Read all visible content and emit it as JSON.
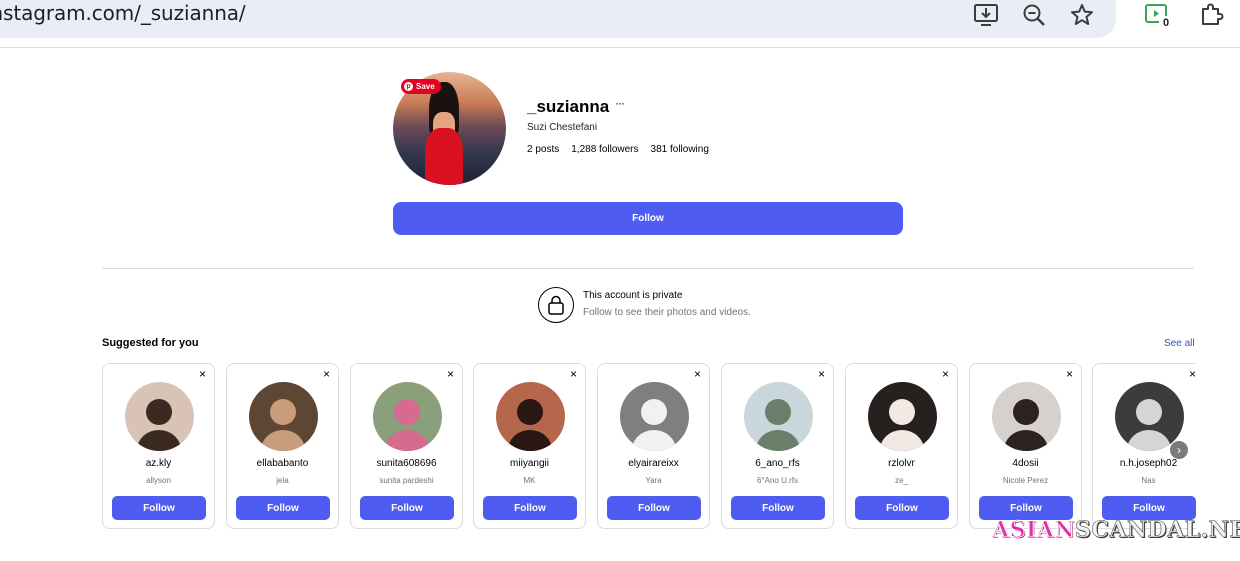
{
  "browser": {
    "url": "instagram.com/_suzianna/",
    "extension_badge": "0",
    "icons": [
      "install-app-icon",
      "zoom-out-icon",
      "bookmark-star-icon",
      "extension-icon",
      "extensions-puzzle-icon"
    ]
  },
  "profile": {
    "save_badge": "Save",
    "username": "_suzianna",
    "more": "···",
    "full_name": "Suzi Chestefani",
    "posts": "2 posts",
    "followers": "1,288 followers",
    "following": "381 following",
    "follow_label": "Follow"
  },
  "private_notice": {
    "title": "This account is private",
    "subtitle": "Follow to see their photos and videos."
  },
  "suggestions": {
    "title": "Suggested for you",
    "see_all": "See all",
    "close_symbol": "×",
    "items": [
      {
        "username": "az.kly",
        "name": "allyson",
        "button": "Follow",
        "bg": "#d9c3b5",
        "fg": "#3b2a22"
      },
      {
        "username": "ellababanto",
        "name": "jela",
        "button": "Follow",
        "bg": "#5d4634",
        "fg": "#c99c7c"
      },
      {
        "username": "sunita608696",
        "name": "sunita pardeshi",
        "button": "Follow",
        "bg": "#8aa07a",
        "fg": "#d66a8f"
      },
      {
        "username": "miiyangii",
        "name": "MK",
        "button": "Follow",
        "bg": "#b5674c",
        "fg": "#2a1612"
      },
      {
        "username": "elyairareixx",
        "name": "Yara",
        "button": "Follow",
        "bg": "#7f7f7f",
        "fg": "#f1f1f1"
      },
      {
        "username": "6_ano_rfs",
        "name": "6°Ano U.rfs",
        "button": "Follow",
        "bg": "#c9d7dc",
        "fg": "#6a7f6a"
      },
      {
        "username": "rzlolvr",
        "name": "ze_",
        "button": "Follow",
        "bg": "#26201e",
        "fg": "#f2e9e3"
      },
      {
        "username": "4dosii",
        "name": "Nicole Perez",
        "button": "Follow",
        "bg": "#d7d1cd",
        "fg": "#2c2220"
      },
      {
        "username": "n.h.joseph02",
        "name": "Nas",
        "button": "Follow",
        "bg": "#3c3c3c",
        "fg": "#d5d5d5"
      }
    ]
  },
  "watermark": {
    "part1": "ASIAN",
    "part2": "SCANDAL.NET"
  }
}
